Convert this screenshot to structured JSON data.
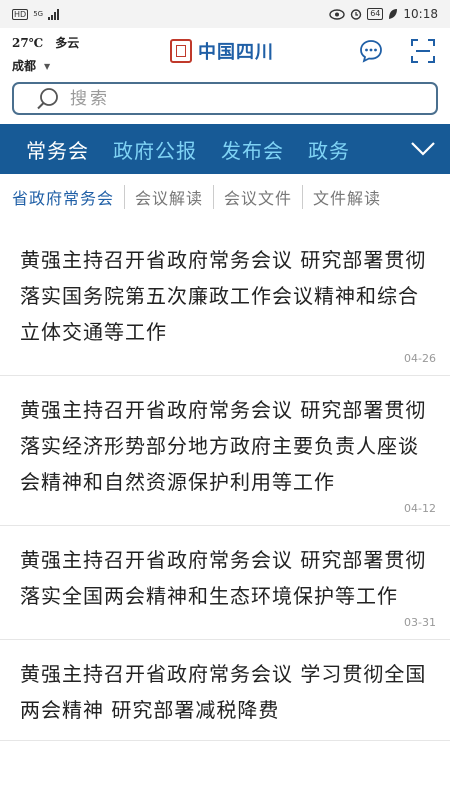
{
  "status_bar": {
    "left_hd": "HD",
    "left_net": "5G",
    "battery": "64",
    "time": "10:18"
  },
  "header": {
    "temperature": "27℃",
    "weather": "多云",
    "city": "成都",
    "brand_name": "中国四川"
  },
  "search": {
    "placeholder": "搜索"
  },
  "channels": {
    "tabs": [
      "常务会",
      "政府公报",
      "发布会",
      "政务"
    ],
    "active_index": 0
  },
  "subtabs": {
    "tabs": [
      "省政府常务会",
      "会议解读",
      "会议文件",
      "文件解读"
    ],
    "active_index": 0
  },
  "news": [
    {
      "title": "黄强主持召开省政府常务会议 研究部署贯彻落实国务院第五次廉政工作会议精神和综合立体交通等工作",
      "date": "04-26"
    },
    {
      "title": "黄强主持召开省政府常务会议 研究部署贯彻落实经济形势部分地方政府主要负责人座谈会精神和自然资源保护利用等工作",
      "date": "04-12"
    },
    {
      "title": "黄强主持召开省政府常务会议 研究部署贯彻落实全国两会精神和生态环境保护等工作",
      "date": "03-31"
    },
    {
      "title": "黄强主持召开省政府常务会议 学习贯彻全国两会精神 研究部署减税降费",
      "date": ""
    }
  ],
  "colors": {
    "channel_bar": "#175a96",
    "channel_active": "#ffffff",
    "channel_inactive": "#7fd3f5",
    "brand_blue": "#1f5fa6",
    "seal_red": "#c0392b"
  }
}
